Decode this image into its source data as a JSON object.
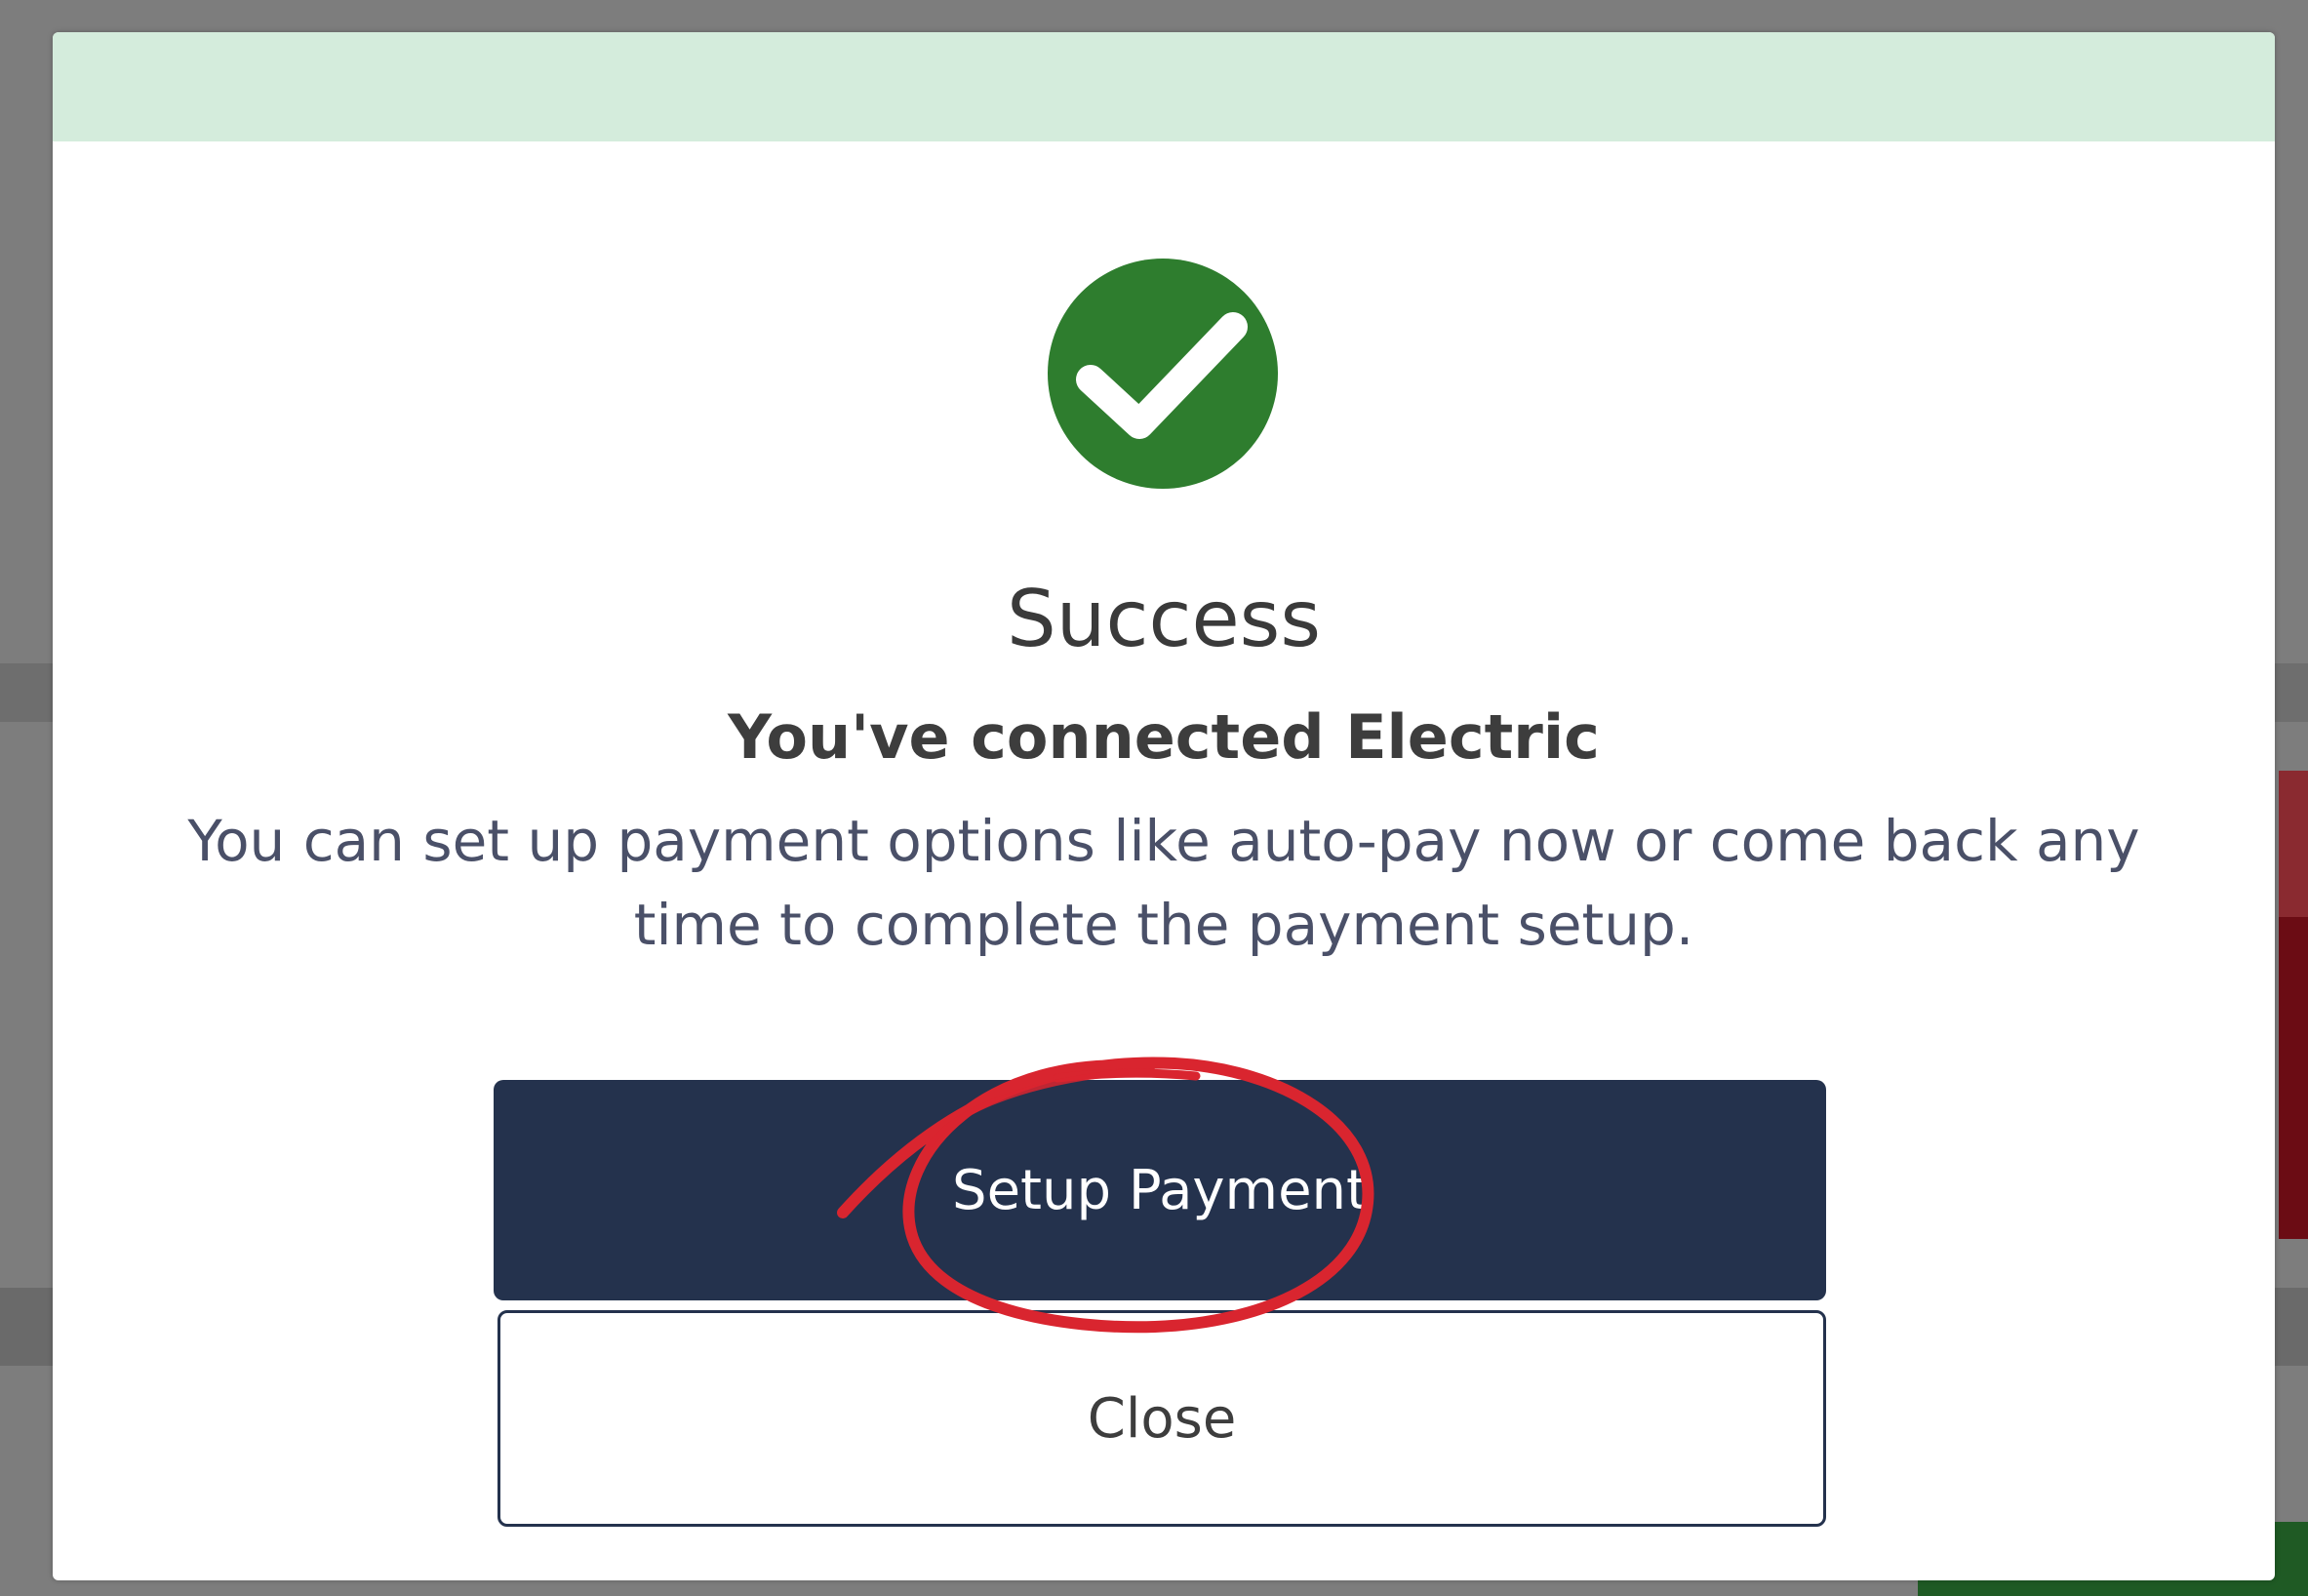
{
  "dialog": {
    "status_icon": "check-circle-icon",
    "title": "Success",
    "subtitle": "You've connected Electric",
    "message": "You can set up payment options like auto-pay now or come back any time to complete the payment setup.",
    "primary_button": "Setup Payment",
    "secondary_button": "Close"
  },
  "colors": {
    "header_band": "#d4ecdc",
    "success_green": "#2e7d2e",
    "primary_button": "#24324d",
    "annotation_circle": "#d9252f",
    "backdrop": "#7d7d7d"
  }
}
